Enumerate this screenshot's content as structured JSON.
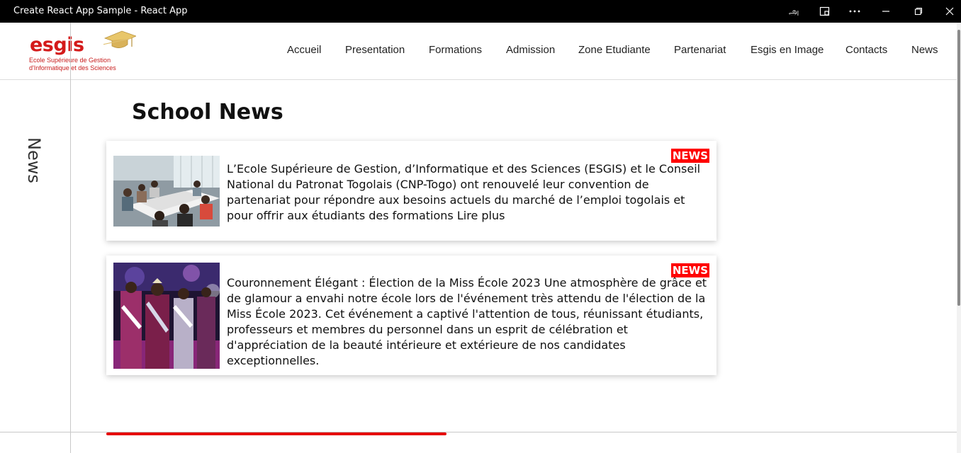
{
  "window": {
    "title": "Create React App Sample - React App",
    "controls": [
      "translate-icon",
      "app-icon",
      "more-icon",
      "minimize-icon",
      "restore-icon",
      "close-icon"
    ]
  },
  "logo": {
    "word": "esgis",
    "line1": "Ecole Supérieure de Gestion",
    "line2": "d'Informatique et des Sciences",
    "brand_color": "#d41a1a"
  },
  "nav": {
    "items": [
      "Accueil",
      "Presentation",
      "Formations",
      "Admission",
      "Zone Etudiante",
      "Partenariat",
      "Esgis en Image",
      "Contacts",
      "News"
    ]
  },
  "sidebar": {
    "label": "News"
  },
  "main": {
    "title": "School News",
    "cards": [
      {
        "badge": "NEWS",
        "text": "L’Ecole Supérieure de Gestion, d’Informatique et des Sciences (ESGIS) et le Conseil National du Patronat Togolais (CNP-Togo) ont renouvelé leur convention de partenariat pour répondre aux besoins actuels du marché de l’emploi togolais et pour offrir aux étudiants des formations Lire plus"
      },
      {
        "badge": "NEWS",
        "text": "Couronnement Élégant : Élection de la Miss École 2023 Une atmosphère de grâce et de glamour a envahi notre école lors de l'événement très attendu de l'élection de la Miss École 2023. Cet événement a captivé l'attention de tous, réunissant étudiants, professeurs et membres du personnel dans un esprit de célébration et d'appréciation de la beauté intérieure et extérieure de nos candidates exceptionnelles."
      }
    ]
  },
  "colors": {
    "accent": "#e60000",
    "badge": "#ff0000"
  }
}
